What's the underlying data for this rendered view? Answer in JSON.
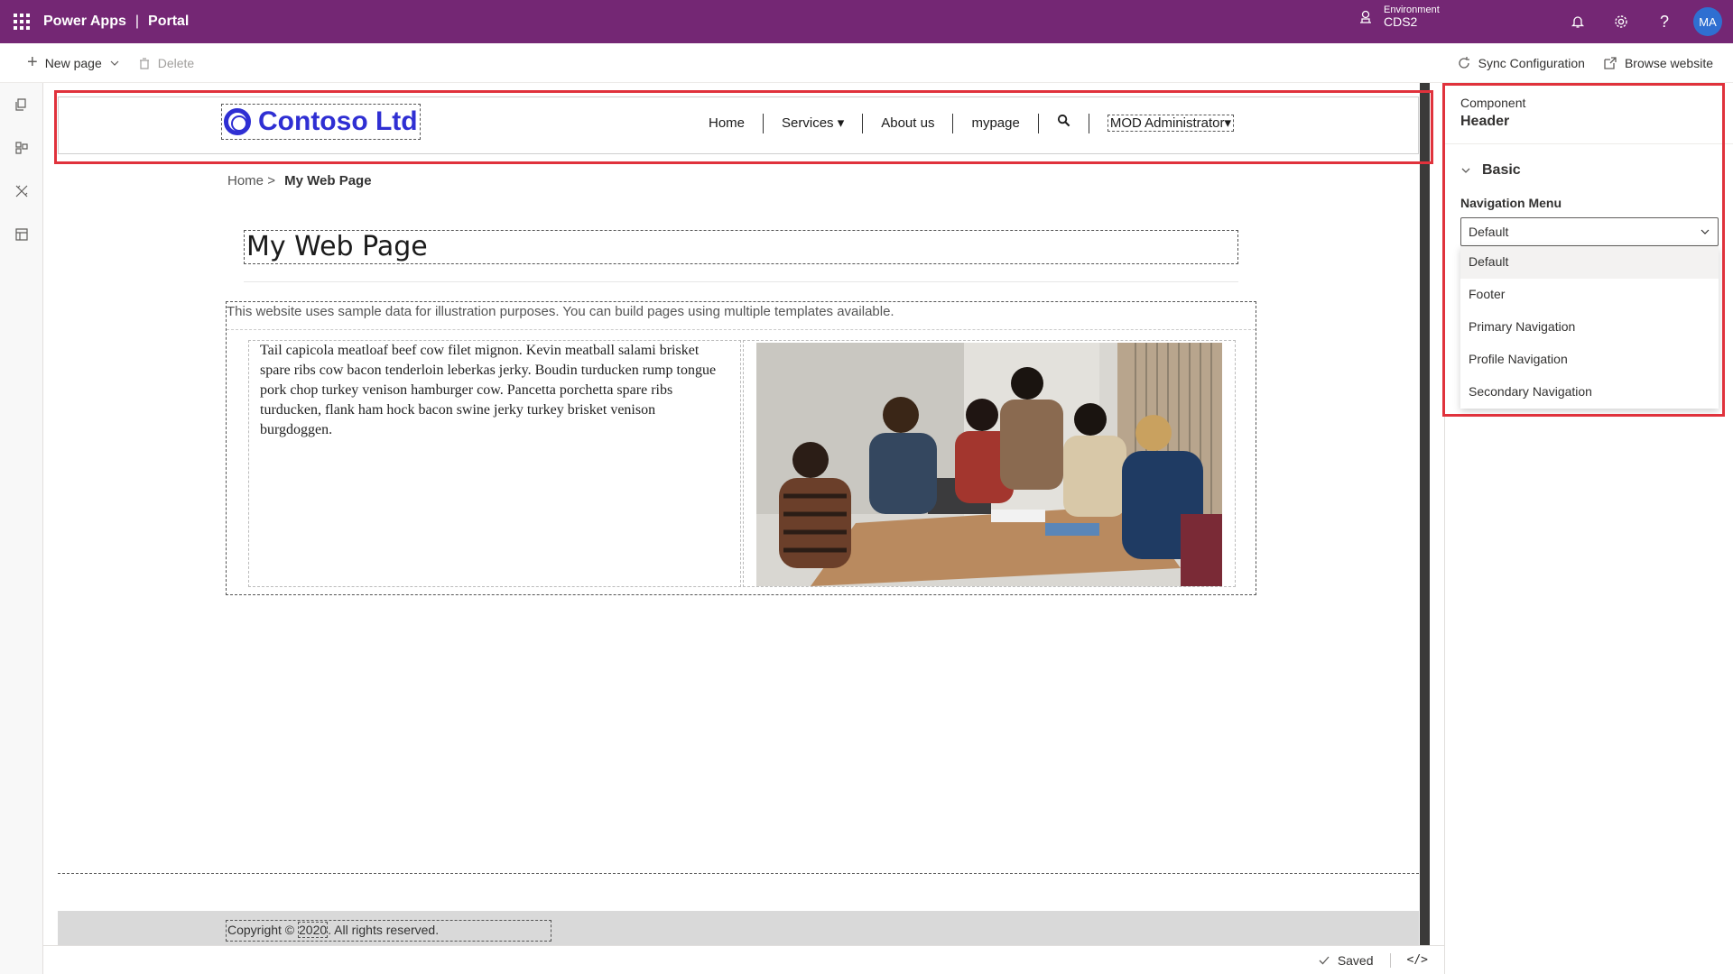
{
  "topbar": {
    "app_name": "Power Apps",
    "separator": "|",
    "section": "Portal",
    "environment_label": "Environment",
    "environment_value": "CDS2",
    "avatar_initials": "MA",
    "color": "#742774"
  },
  "commandbar": {
    "new_page": "New page",
    "delete": "Delete",
    "sync": "Sync Configuration",
    "browse": "Browse website"
  },
  "site": {
    "logo": "Contoso Ltd",
    "logo_color": "#2f2fd3",
    "nav": [
      "Home",
      "Services ▾",
      "About us",
      "mypage"
    ],
    "admin": "MOD Administrator▾",
    "breadcrumb_home": "Home",
    "breadcrumb_sep": ">",
    "breadcrumb_current": "My Web Page",
    "page_title": "My Web Page",
    "intro": "This website uses sample data for illustration purposes. You can build pages using multiple templates available.",
    "body": "Tail capicola meatloaf beef cow filet mignon. Kevin meatball salami brisket spare ribs cow bacon tenderloin leberkas jerky. Boudin turducken rump tongue pork chop turkey venison hamburger cow. Pancetta porchetta spare ribs turducken, flank ham hock bacon swine jerky turkey brisket venison burgdoggen.",
    "copyright_pre": "Copyright © ",
    "copyright_year": "2020",
    "copyright_post": ". All rights reserved."
  },
  "panel": {
    "component_label": "Component",
    "component_name": "Header",
    "section": "Basic",
    "field_label": "Navigation Menu",
    "selected": "Default",
    "options": [
      "Default",
      "Footer",
      "Primary Navigation",
      "Profile Navigation",
      "Secondary Navigation"
    ]
  },
  "status": {
    "saved": "Saved",
    "code": "</>"
  },
  "highlight_color": "#e0323c"
}
